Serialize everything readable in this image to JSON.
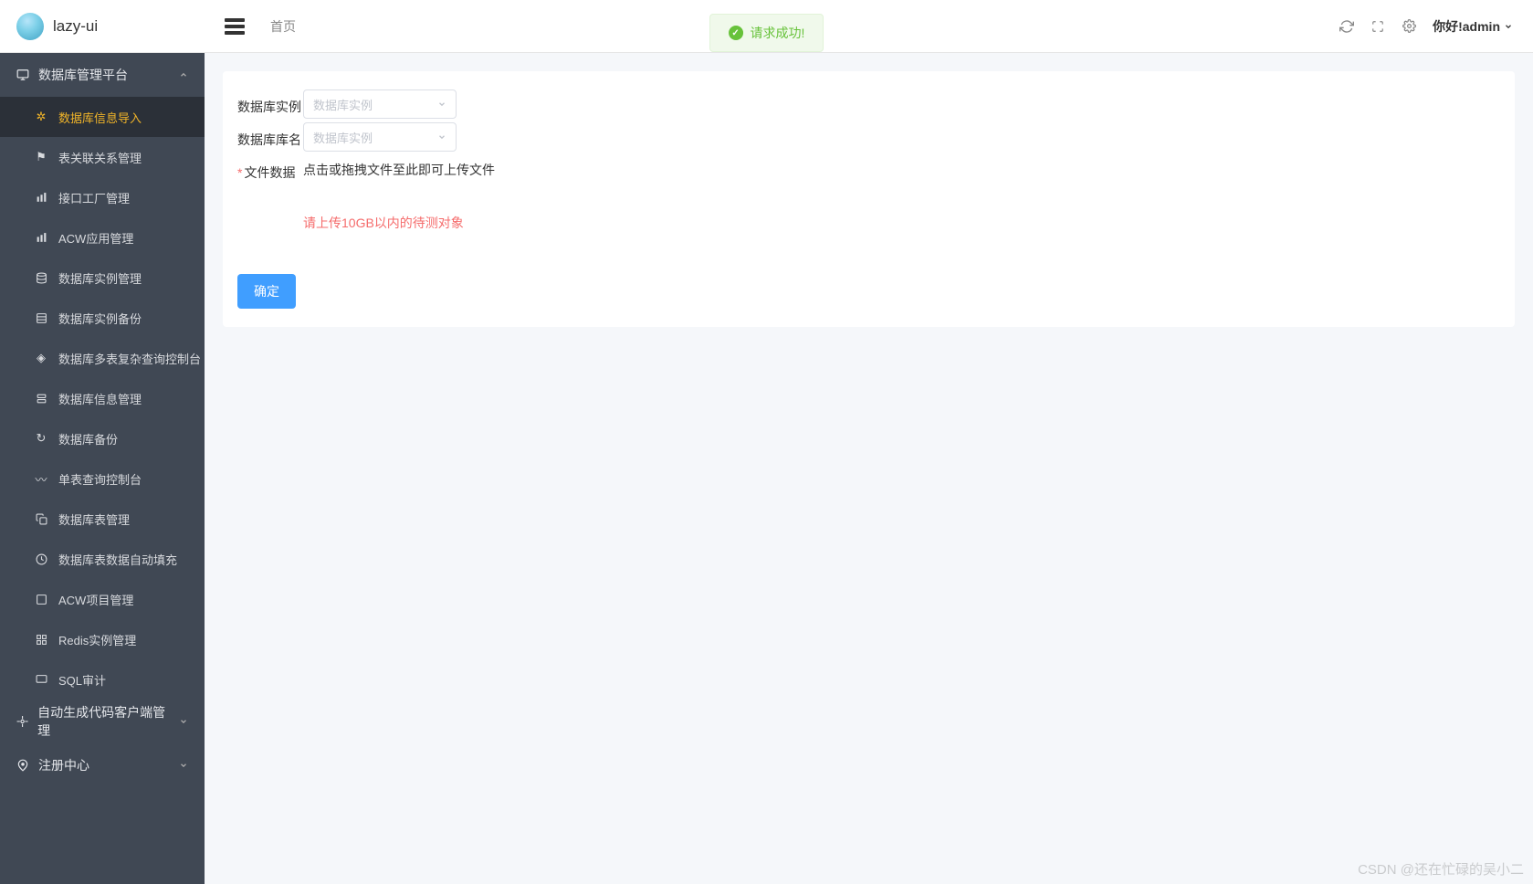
{
  "header": {
    "app_name": "lazy-ui",
    "breadcrumb": "首页",
    "user_greeting": "你好!admin"
  },
  "toast": {
    "message": "请求成功!"
  },
  "sidebar": {
    "groups": [
      {
        "label": "数据库管理平台",
        "expanded": true,
        "items": [
          {
            "label": "数据库信息导入",
            "icon": "loading",
            "active": true
          },
          {
            "label": "表关联关系管理",
            "icon": "flag"
          },
          {
            "label": "接口工厂管理",
            "icon": "bars"
          },
          {
            "label": "ACW应用管理",
            "icon": "bars"
          },
          {
            "label": "数据库实例管理",
            "icon": "database"
          },
          {
            "label": "数据库实例备份",
            "icon": "backup"
          },
          {
            "label": "数据库多表复杂查询控制台",
            "icon": "compass"
          },
          {
            "label": "数据库信息管理",
            "icon": "stack"
          },
          {
            "label": "数据库备份",
            "icon": "export"
          },
          {
            "label": "单表查询控制台",
            "icon": "wave"
          },
          {
            "label": "数据库表管理",
            "icon": "copy"
          },
          {
            "label": "数据库表数据自动填充",
            "icon": "clock"
          },
          {
            "label": "ACW项目管理",
            "icon": "folder"
          },
          {
            "label": "Redis实例管理",
            "icon": "grid"
          },
          {
            "label": "SQL审计",
            "icon": "monitor"
          }
        ]
      },
      {
        "label": "自动生成代码客户端管理",
        "expanded": false,
        "items": []
      },
      {
        "label": "注册中心",
        "expanded": false,
        "items": []
      }
    ]
  },
  "form": {
    "field_instance": {
      "label": "数据库实例",
      "placeholder": "数据库实例"
    },
    "field_dbname": {
      "label": "数据库库名",
      "placeholder": "数据库实例"
    },
    "field_file": {
      "label": "文件数据",
      "required_mark": "*",
      "upload_text": "点击或拖拽文件至此即可上传文件",
      "upload_hint": "请上传10GB以内的待测对象"
    },
    "submit_label": "确定"
  },
  "watermark": "CSDN @还在忙碌的吴小二"
}
